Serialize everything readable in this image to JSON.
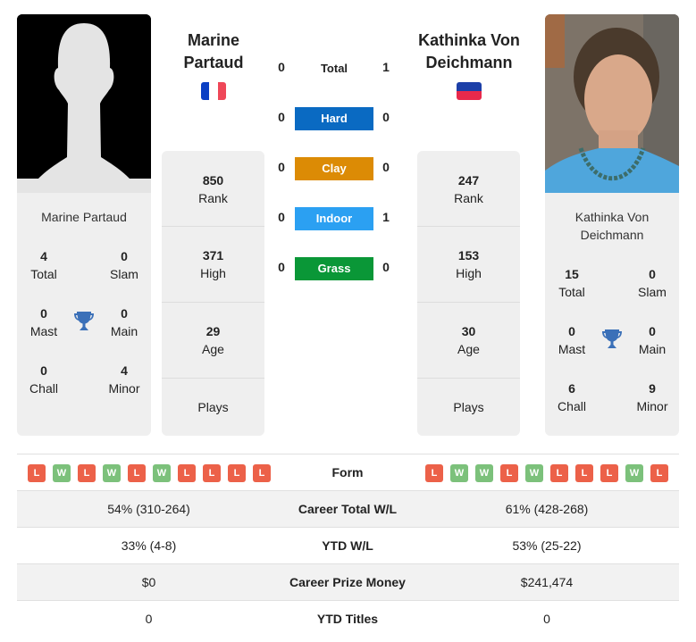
{
  "player1": {
    "name": "Marine Partaud",
    "name_line1": "Marine",
    "name_line2": "Partaud",
    "flag": "france-flag",
    "flag_colors": [
      "#0a3fc4",
      "#ffffff",
      "#ef4758"
    ],
    "rank": "850",
    "rank_label": "Rank",
    "high": "371",
    "high_label": "High",
    "age": "29",
    "age_label": "Age",
    "plays_label": "Plays",
    "titles": {
      "total": "4",
      "total_label": "Total",
      "slam": "0",
      "slam_label": "Slam",
      "mast": "0",
      "mast_label": "Mast",
      "main": "0",
      "main_label": "Main",
      "chall": "0",
      "chall_label": "Chall",
      "minor": "4",
      "minor_label": "Minor"
    },
    "form": [
      "L",
      "W",
      "L",
      "W",
      "L",
      "W",
      "L",
      "L",
      "L",
      "L"
    ],
    "career_wl": "54% (310-264)",
    "ytd_wl": "33% (4-8)",
    "prize_money": "$0",
    "ytd_titles": "0"
  },
  "player2": {
    "name": "Kathinka Von Deichmann",
    "name_line1": "Kathinka Von",
    "name_line2": "Deichmann",
    "card_line1": "Kathinka Von",
    "card_line2": "Deichmann",
    "flag": "liechtenstein-flag",
    "flag_colors": [
      "#1c3fa8",
      "#e8294b"
    ],
    "rank": "247",
    "rank_label": "Rank",
    "high": "153",
    "high_label": "High",
    "age": "30",
    "age_label": "Age",
    "plays_label": "Plays",
    "titles": {
      "total": "15",
      "total_label": "Total",
      "slam": "0",
      "slam_label": "Slam",
      "mast": "0",
      "mast_label": "Mast",
      "main": "0",
      "main_label": "Main",
      "chall": "6",
      "chall_label": "Chall",
      "minor": "9",
      "minor_label": "Minor"
    },
    "form": [
      "L",
      "W",
      "W",
      "L",
      "W",
      "L",
      "L",
      "L",
      "W",
      "L"
    ],
    "career_wl": "61% (428-268)",
    "ytd_wl": "53% (25-22)",
    "prize_money": "$241,474",
    "ytd_titles": "0"
  },
  "h2h": [
    {
      "label": "Total",
      "p1": "0",
      "p2": "1",
      "color": null
    },
    {
      "label": "Hard",
      "p1": "0",
      "p2": "0",
      "color": "#0a6ac2"
    },
    {
      "label": "Clay",
      "p1": "0",
      "p2": "0",
      "color": "#dc8b05"
    },
    {
      "label": "Indoor",
      "p1": "0",
      "p2": "1",
      "color": "#2ba0f2"
    },
    {
      "label": "Grass",
      "p1": "0",
      "p2": "0",
      "color": "#0a9737"
    }
  ],
  "table": {
    "form_label": "Form",
    "career_wl_label": "Career Total W/L",
    "ytd_wl_label": "YTD W/L",
    "prize_label": "Career Prize Money",
    "ytd_titles_label": "YTD Titles"
  }
}
